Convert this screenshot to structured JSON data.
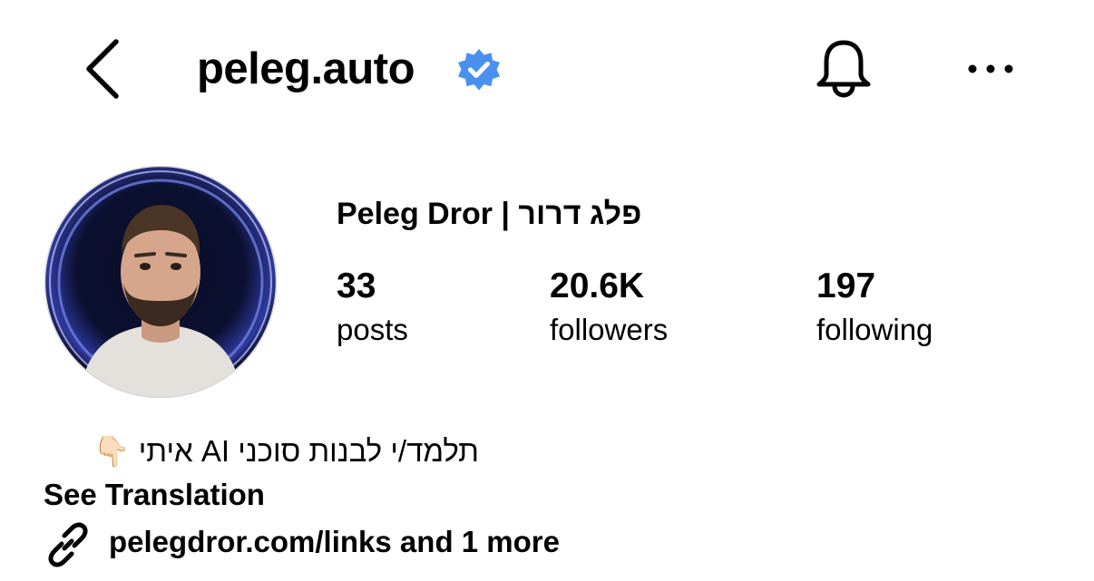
{
  "header": {
    "back_icon": "chevron-left-icon",
    "username": "peleg.auto",
    "verified_icon": "verified-badge-icon",
    "verified_color": "#4a90f0",
    "bell_icon": "bell-icon",
    "more_icon": "more-horizontal-icon"
  },
  "profile": {
    "avatar_icon": "profile-photo",
    "display_name": "Peleg Dror | פלג דרור",
    "stats": {
      "posts": {
        "value": "33",
        "label": "posts"
      },
      "followers": {
        "value": "20.6K",
        "label": "followers"
      },
      "following": {
        "value": "197",
        "label": "following"
      }
    },
    "bio": "תלמד/י לבנות סוכני AI איתי 👇🏻",
    "see_translation": "See Translation",
    "link_icon": "link-icon",
    "link_text": "pelegdror.com/links and 1 more"
  }
}
